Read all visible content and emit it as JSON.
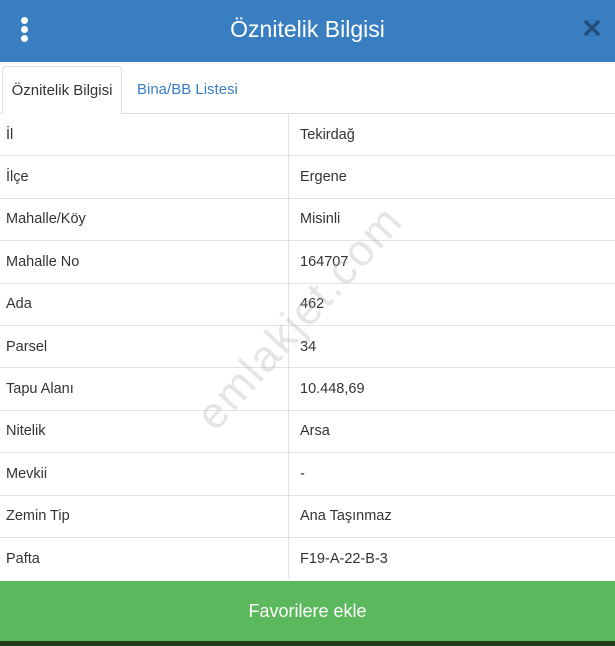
{
  "header": {
    "title": "Öznitelik Bilgisi",
    "menu_icon": "kebab-menu-icon",
    "close_icon": "close-icon",
    "colors": {
      "bar": "#3a7ec2",
      "text": "#ffffff"
    }
  },
  "tabs": [
    {
      "label": "Öznitelik Bilgisi",
      "active": true
    },
    {
      "label": "Bina/BB Listesi",
      "active": false
    }
  ],
  "attributes": [
    {
      "key": "İl",
      "value": "Tekirdağ"
    },
    {
      "key": "İlçe",
      "value": "Ergene"
    },
    {
      "key": "Mahalle/Köy",
      "value": "Misinli"
    },
    {
      "key": "Mahalle No",
      "value": "164707"
    },
    {
      "key": "Ada",
      "value": "462"
    },
    {
      "key": "Parsel",
      "value": "34"
    },
    {
      "key": "Tapu Alanı",
      "value": "10.448,69"
    },
    {
      "key": "Nitelik",
      "value": "Arsa"
    },
    {
      "key": "Mevkii",
      "value": "-"
    },
    {
      "key": "Zemin Tip",
      "value": "Ana Taşınmaz"
    },
    {
      "key": "Pafta",
      "value": "F19-A-22-B-3"
    }
  ],
  "watermark": "emlakjet.com",
  "footer": {
    "favorite_label": "Favorilere ekle",
    "color": "#5cb85c"
  }
}
